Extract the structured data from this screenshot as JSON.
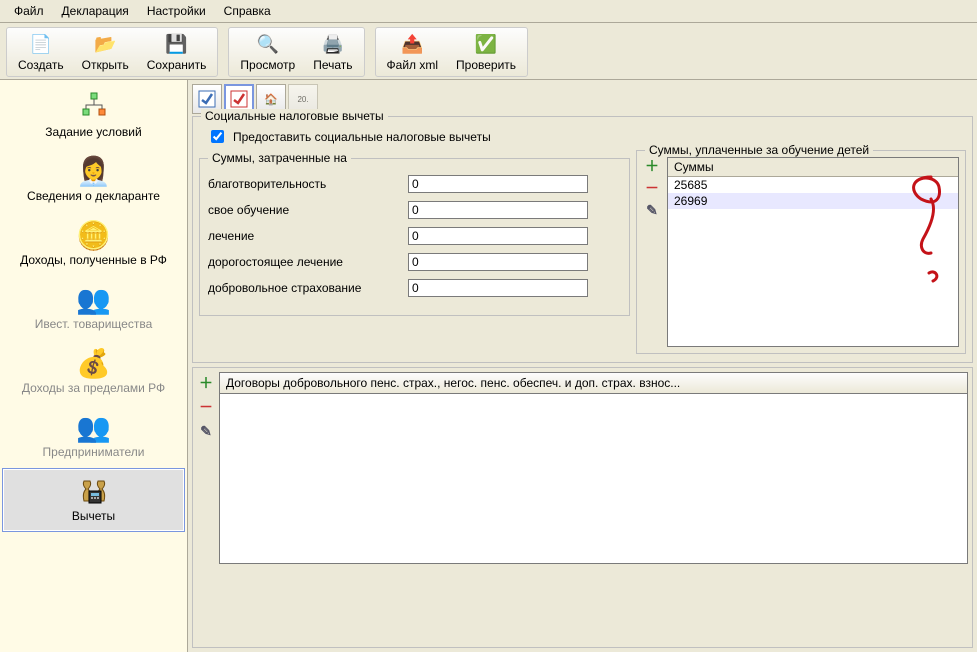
{
  "menu": [
    "Файл",
    "Декларация",
    "Настройки",
    "Справка"
  ],
  "toolbar": {
    "create": "Создать",
    "open": "Открыть",
    "save": "Сохранить",
    "preview": "Просмотр",
    "print": "Печать",
    "filexml": "Файл xml",
    "check": "Проверить"
  },
  "sidebar": {
    "items": [
      {
        "label": "Задание условий"
      },
      {
        "label": "Сведения о декларанте"
      },
      {
        "label": "Доходы, полученные в РФ"
      },
      {
        "label": "Ивест. товарищества",
        "disabled": true
      },
      {
        "label": "Доходы за пределами РФ",
        "disabled": true
      },
      {
        "label": "Предприниматели",
        "disabled": true
      },
      {
        "label": "Вычеты",
        "active": true
      }
    ]
  },
  "tabs": {
    "doc_label": "20."
  },
  "panel": {
    "group_title": "Социальные налоговые вычеты",
    "provide_label": "Предоставить социальные налоговые вычеты",
    "provide_checked": true,
    "left_group_title": "Суммы, затраченные на",
    "fields": {
      "charity_label": "благотворительность",
      "charity": "0",
      "own_edu_label": "свое обучение",
      "own_edu": "0",
      "treatment_label": "лечение",
      "treatment": "0",
      "expensive_label": "дорогостоящее лечение",
      "expensive": "0",
      "insurance_label": "добровольное страхование",
      "insurance": "0"
    },
    "right_group_title": "Суммы, уплаченные за обучение детей",
    "right_header": "Суммы",
    "right_rows": [
      "25685",
      "26969"
    ]
  },
  "bottom": {
    "header": "Договоры добровольного пенс. страх., негос. пенс. обеспеч. и доп. страх. взнос..."
  }
}
